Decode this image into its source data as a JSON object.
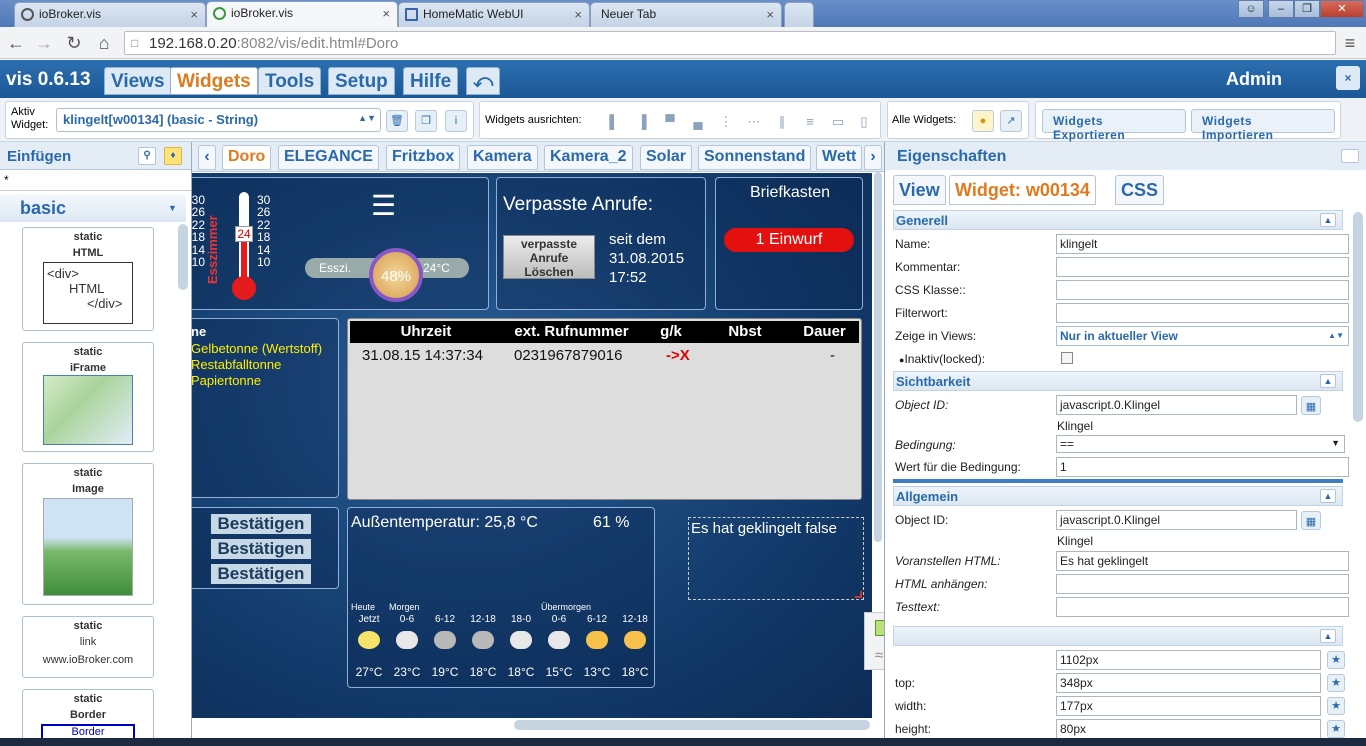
{
  "browser": {
    "tabs": [
      {
        "label": "ioBroker.vis",
        "active": false
      },
      {
        "label": "ioBroker.vis",
        "active": true
      },
      {
        "label": "HomeMatic WebUI",
        "active": false
      },
      {
        "label": "Neuer Tab",
        "active": false
      }
    ],
    "url_host": "192.168.0.20",
    "url_path": ":8082/vis/edit.html#Doro"
  },
  "app": {
    "title": "vis 0.6.13",
    "menu": [
      "Views",
      "Widgets",
      "Tools",
      "Setup",
      "Hilfe"
    ],
    "active_menu": "Widgets",
    "user": "Admin"
  },
  "toolbar": {
    "active_widget_label": "Aktiv Widget:",
    "active_widget": "klingelt[w00134] (basic - String)",
    "align_label": "Widgets ausrichten:",
    "all_widgets_label": "Alle Widgets:",
    "export": "Widgets Exportieren",
    "import": "Widgets Importieren"
  },
  "left": {
    "title": "Einfügen",
    "filter": "*",
    "category": "basic",
    "items": [
      {
        "l1": "static",
        "l2": "HTML"
      },
      {
        "l1": "static",
        "l2": "iFrame"
      },
      {
        "l1": "static",
        "l2": "Image"
      },
      {
        "l1": "static",
        "l2": "link",
        "l3": "www.ioBroker.com"
      },
      {
        "l1": "static",
        "l2": "Border",
        "l3": "Border"
      }
    ],
    "html_preview": [
      "<div>",
      "HTML",
      "</div>"
    ]
  },
  "views": [
    "Doro",
    "ELEGANCE",
    "Fritzbox",
    "Kamera",
    "Kamera_2",
    "Solar",
    "Sonnenstand",
    "Wett"
  ],
  "active_view": "Doro",
  "stage": {
    "thermo_scale_left": [
      "30",
      "26",
      "22",
      "18",
      "14",
      "10"
    ],
    "thermo_scale_right": [
      "30",
      "26",
      "22",
      "18",
      "14",
      "10"
    ],
    "thermo_value": "24",
    "thermo_room": "Esszimmer",
    "heating_room": "Esszi.",
    "heating_percent": "48%",
    "heating_setpoint": "24°C",
    "missed_title": "Verpasste Anrufe:",
    "missed_btn": "verpasste Anrufe Löschen",
    "missed_since": [
      "seit dem",
      "31.08.2015",
      "17:52"
    ],
    "mailbox_title": "Briefkasten",
    "mailbox_badge": "1 Einwurf",
    "calls_headers": [
      "Uhrzeit",
      "ext. Rufnummer",
      "g/k",
      "Nbst",
      "Dauer"
    ],
    "calls_rows": [
      [
        "31.08.15 14:37:34",
        "0231967879016",
        "->X",
        "",
        "-"
      ]
    ],
    "waste_head": "ne",
    "waste_items": [
      "Gelbetonne (Wertstoff)",
      "Restabfalltonne",
      "Papiertonne"
    ],
    "confirm": [
      "Bestätigen",
      "Bestätigen",
      "Bestätigen"
    ],
    "weather_temp": "Außentemperatur: 25,8 °C",
    "weather_hum": "61 %",
    "forecast_groups": [
      "Heute",
      "Morgen",
      "Übermorgen"
    ],
    "forecast": [
      {
        "slot": "Jetzt",
        "temp": "27°C",
        "icon": "sun"
      },
      {
        "slot": "0-6",
        "temp": "23°C",
        "icon": "cloud-sun"
      },
      {
        "slot": "6-12",
        "temp": "19°C",
        "icon": "rain"
      },
      {
        "slot": "12-18",
        "temp": "18°C",
        "icon": "rain"
      },
      {
        "slot": "18-0",
        "temp": "18°C",
        "icon": "cloud-sun"
      },
      {
        "slot": "0-6",
        "temp": "15°C",
        "icon": "cloud-sun"
      },
      {
        "slot": "6-12",
        "temp": "13°C",
        "icon": "sun-cloud"
      },
      {
        "slot": "12-18",
        "temp": "18°C",
        "icon": "sun-cloud"
      }
    ],
    "bell_text": "Es hat geklingelt false"
  },
  "right": {
    "title": "Eigenschaften",
    "tabs": [
      "View",
      "Widget: w00134",
      "CSS"
    ],
    "active_tab": "Widget: w00134",
    "sections": {
      "general": "Generell",
      "visibility": "Sichtbarkeit",
      "common": "Allgemein"
    },
    "general": [
      {
        "label": "Name:",
        "value": "klingelt"
      },
      {
        "label": "Kommentar:",
        "value": ""
      },
      {
        "label": "CSS Klasse::",
        "value": ""
      },
      {
        "label": "Filterwort:",
        "value": ""
      }
    ],
    "views_label": "Zeige in Views:",
    "views_value": "Nur in aktueller View",
    "locked_label": "Inaktiv(locked):",
    "vis_oid_label": "Object ID:",
    "vis_oid": "javascript.0.Klingel",
    "vis_oid_name": "Klingel",
    "cond_label": "Bedingung:",
    "cond_value": "==",
    "condval_label": "Wert für die Bedingung:",
    "condval": "1",
    "oid_label": "Object ID:",
    "oid": "javascript.0.Klingel",
    "oid_name": "Klingel",
    "prepend_label": "Voranstellen HTML:",
    "prepend": "Es hat geklingelt",
    "append_label": "HTML anhängen:",
    "append": "",
    "testtext_label": "Testtext:",
    "css": [
      {
        "label": "top:",
        "value": "348px"
      },
      {
        "label": "width:",
        "value": "177px"
      },
      {
        "label": "height:",
        "value": "80px"
      }
    ],
    "left_value": "1102px"
  },
  "colors": {
    "accent": "#e07a1f",
    "brand": "#2a6aab",
    "header": "#1c5795",
    "alert": "#e00000"
  }
}
